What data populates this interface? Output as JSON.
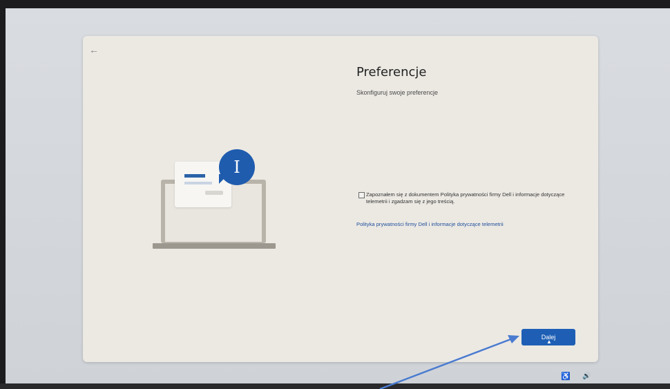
{
  "back": {
    "icon": "back-arrow-icon",
    "glyph": "←"
  },
  "page": {
    "title": "Preferencje",
    "subtitle": "Skonfiguruj swoje preferencje"
  },
  "consent": {
    "checked": false,
    "text": "Zapoznałem się z dokumentem Polityka prywatności firmy Dell i informacje dotyczące telemetrii i zgadzam się z jego treścią."
  },
  "privacy_link": "Polityka prywatności firmy Dell i informacje dotyczące telemetrii",
  "buttons": {
    "next_label": "Dalej"
  },
  "illustration": {
    "bubble_icon": "text-cursor-icon",
    "glyph": "I"
  },
  "taskbar": {
    "accessibility_icon": "accessibility-icon",
    "accessibility_glyph": "♿",
    "volume_icon": "volume-icon",
    "volume_glyph": "🔊"
  },
  "colors": {
    "accent": "#1e5fb5",
    "card": "#ece9e3",
    "annotation_arrow": "#4a7bd0"
  }
}
